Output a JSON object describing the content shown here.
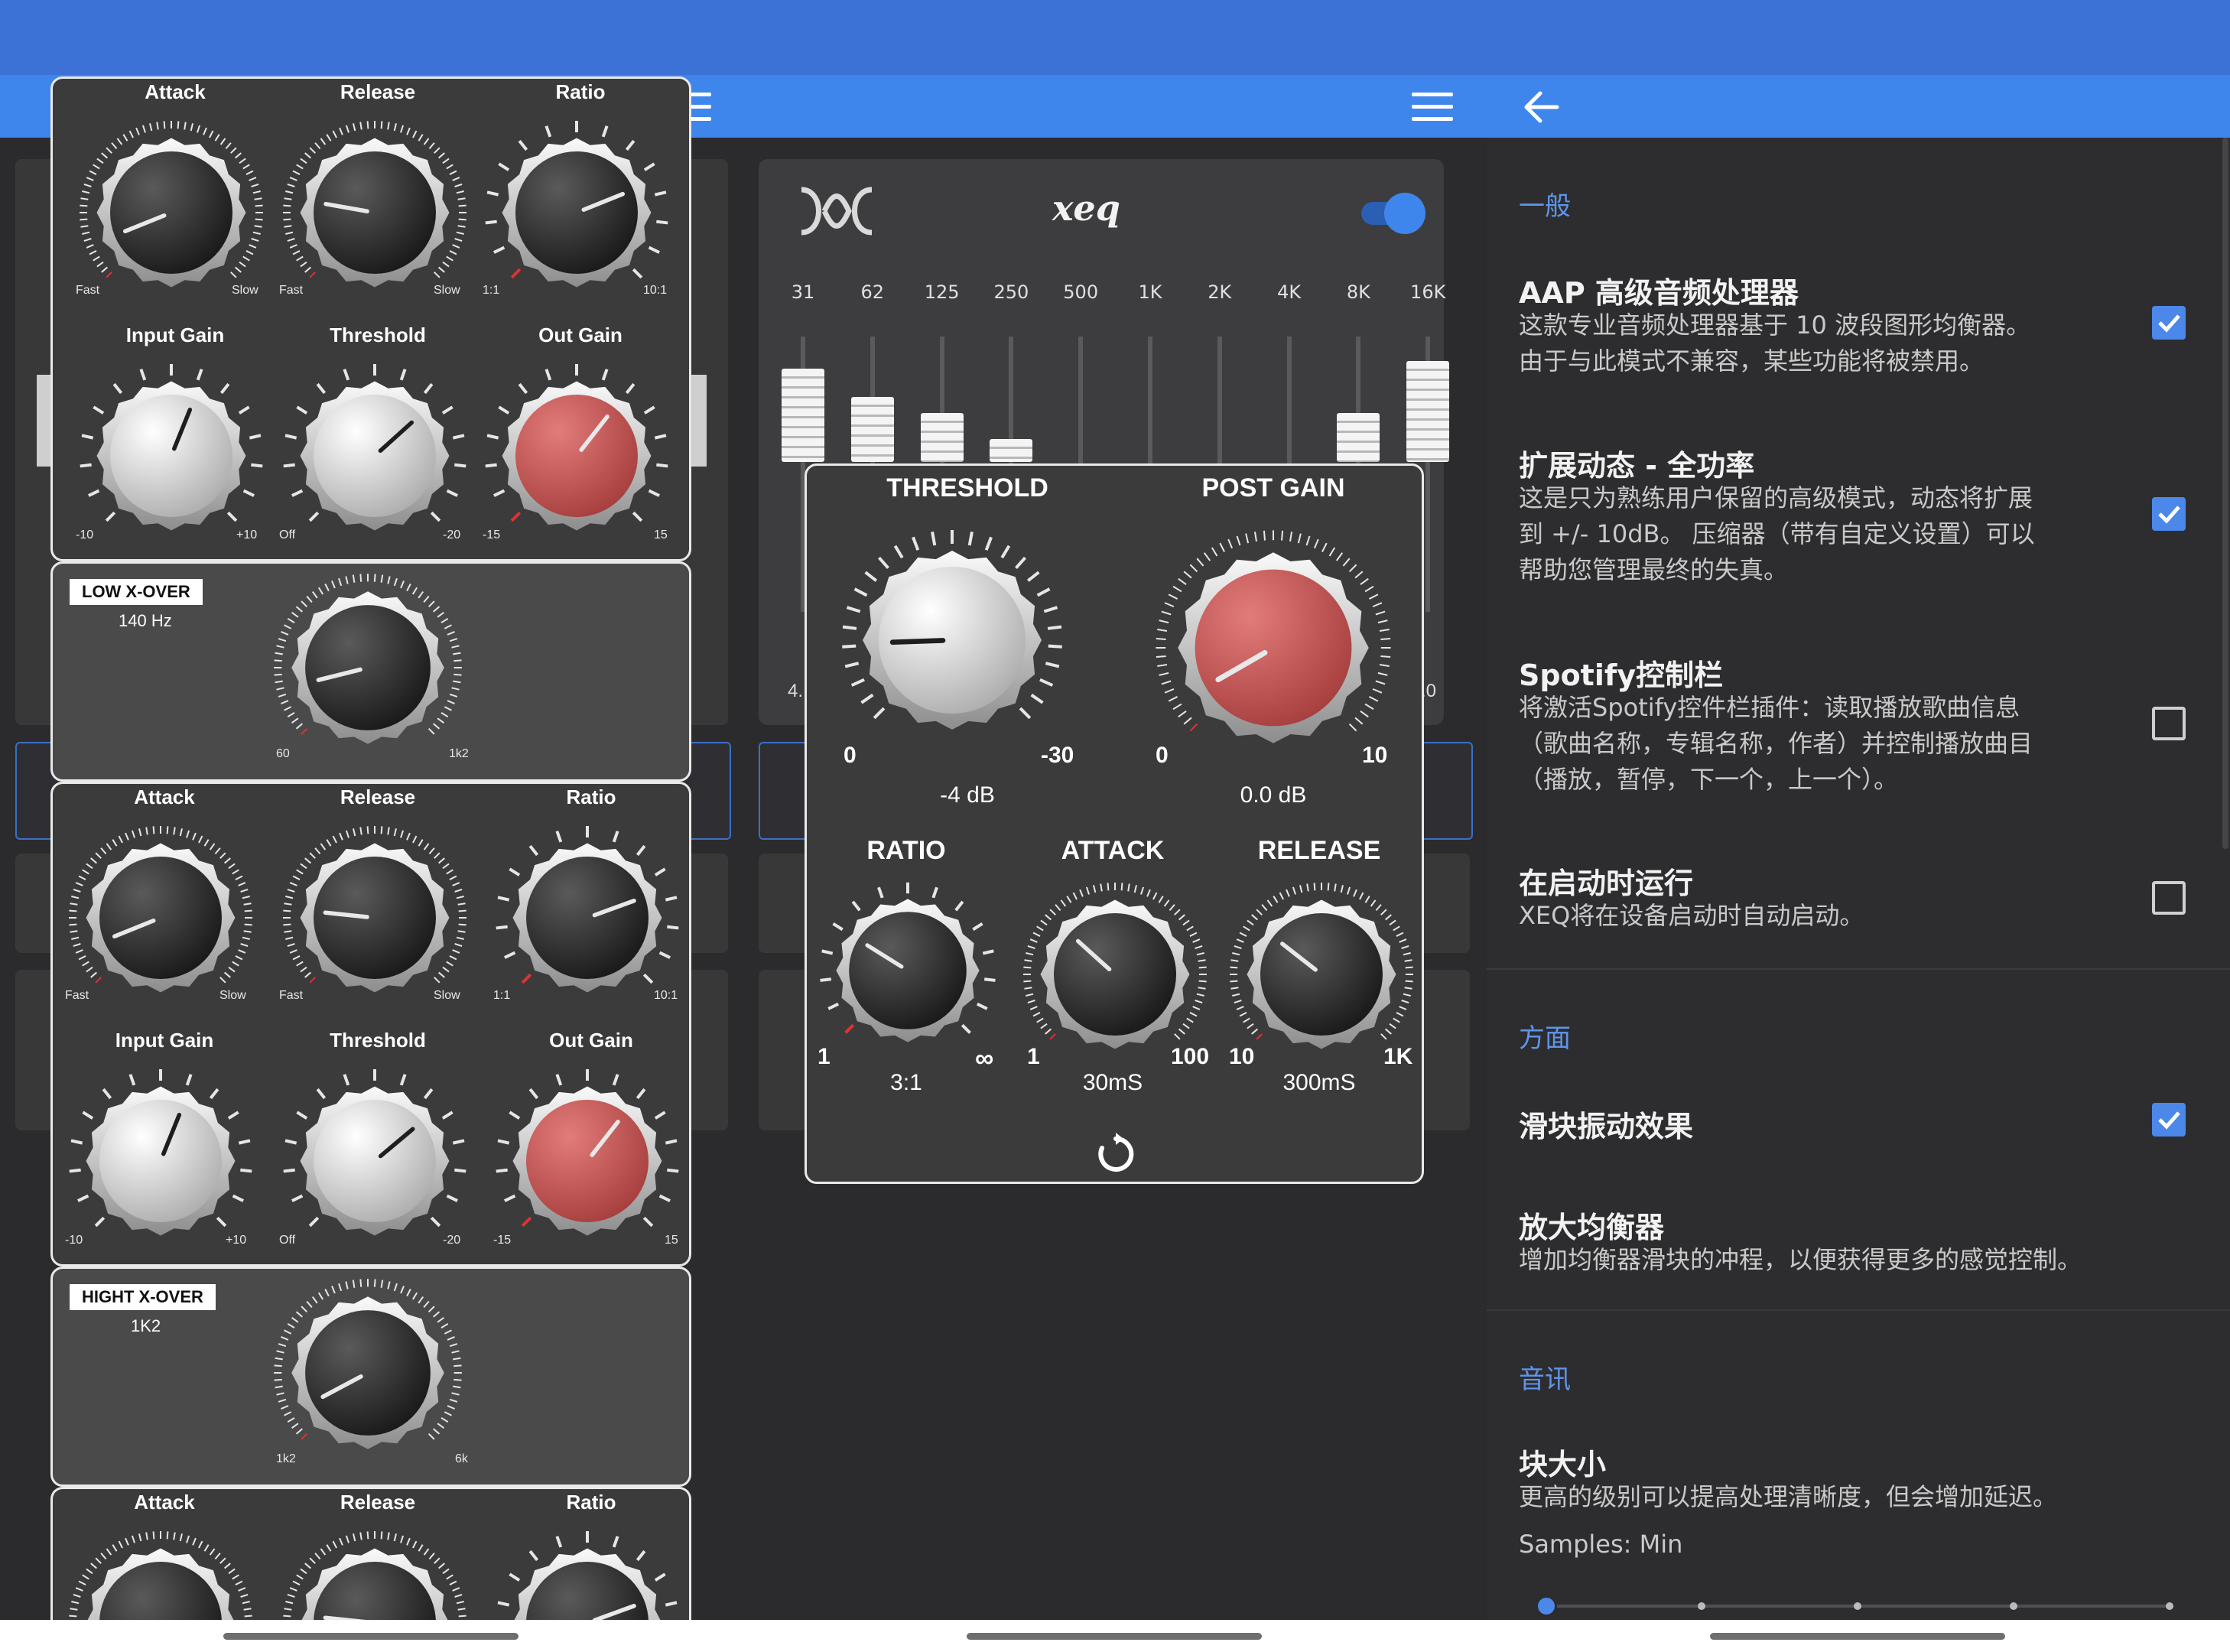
{
  "compressor": {
    "groups": [
      {
        "attack": "Attack",
        "release": "Release",
        "ratio": "Ratio",
        "input_gain": "Input Gain",
        "threshold": "Threshold",
        "out_gain": "Out Gain",
        "fast": "Fast",
        "slow": "Slow",
        "fast2": "Fast",
        "slow2": "Slow",
        "r_min": "1:1",
        "r_max": "10:1",
        "ig_min": "-10",
        "ig_max": "+10",
        "th_min": "Off",
        "th_max": "-20",
        "og_min": "-15",
        "og_max": "15"
      },
      {
        "attack": "Attack",
        "release": "Release",
        "ratio": "Ratio",
        "input_gain": "Input Gain",
        "threshold": "Threshold",
        "out_gain": "Out Gain",
        "fast": "Fast",
        "slow": "Slow",
        "fast2": "Fast",
        "slow2": "Slow",
        "r_min": "1:1",
        "r_max": "10:1",
        "ig_min": "-10",
        "ig_max": "+10",
        "th_min": "Off",
        "th_max": "-20",
        "og_min": "-15",
        "og_max": "15"
      },
      {
        "attack": "Attack",
        "release": "Release",
        "ratio": "Ratio"
      }
    ],
    "low_xover": {
      "label": "LOW X-OVER",
      "value": "140 Hz",
      "min": "60",
      "max": "1k2"
    },
    "high_xover": {
      "label": "HIGHT X-OVER",
      "value": "1K2",
      "min": "1k2",
      "max": "6k"
    }
  },
  "eq": {
    "bands": [
      "31",
      "62",
      "125",
      "250",
      "500",
      "1K",
      "2K",
      "4K",
      "8K",
      "16K"
    ],
    "levels": [
      0.33,
      0.22,
      0.16,
      0.06,
      0,
      0,
      0,
      0,
      0.16,
      0.36
    ],
    "enabled": true,
    "partial_left": "4.",
    "partial_right": ".0"
  },
  "dynamics": {
    "threshold": {
      "label": "THRESHOLD",
      "min": "0",
      "max": "-30",
      "value": "-4 dB"
    },
    "post_gain": {
      "label": "POST GAIN",
      "min": "0",
      "max": "10",
      "value": "0.0 dB"
    },
    "ratio": {
      "label": "RATIO",
      "min": "1",
      "max": "∞",
      "value": "3:1"
    },
    "attack": {
      "label": "ATTACK",
      "min": "1",
      "max": "100",
      "value": "30mS"
    },
    "release": {
      "label": "RELEASE",
      "min": "10",
      "max": "1K",
      "value": "300mS"
    }
  },
  "settings": {
    "sections": {
      "general": "一般",
      "appearance": "方面",
      "audio": "音讯"
    },
    "items": [
      {
        "title": "AAP 高级音频处理器",
        "desc": "这款专业音频处理器基于 10 波段图形均衡器。\n由于与此模式不兼容，某些功能将被禁用。",
        "checked": true
      },
      {
        "title": "扩展动态 - 全功率",
        "desc": "这是只为熟练用户保留的高级模式，动态将扩展\n到 +/- 10dB。 压缩器（带有自定义设置）可以\n帮助您管理最终的失真。",
        "checked": true
      },
      {
        "title": "Spotify控制栏",
        "desc": "将激活Spotify控件栏插件：读取播放歌曲信息\n（歌曲名称，专辑名称，作者）并控制播放曲目\n（播放，暂停，下一个，上一个）。",
        "checked": false
      },
      {
        "title": "在启动时运行",
        "desc": "XEQ将在设备启动时自动启动。",
        "checked": false
      },
      {
        "title": "滑块振动效果",
        "desc": "",
        "checked": true
      },
      {
        "title": "放大均衡器",
        "desc": "增加均衡器滑块的冲程，以便获得更多的感觉控制。",
        "checked": null
      },
      {
        "title": "块大小",
        "desc": "更高的级别可以提高处理清晰度，但会增加延迟。",
        "checked": null
      }
    ],
    "samples_label": "Samples: Min",
    "samples_level": 0
  },
  "colors": {
    "accent": "#3f86ec",
    "red_knob": "#c5504f"
  }
}
